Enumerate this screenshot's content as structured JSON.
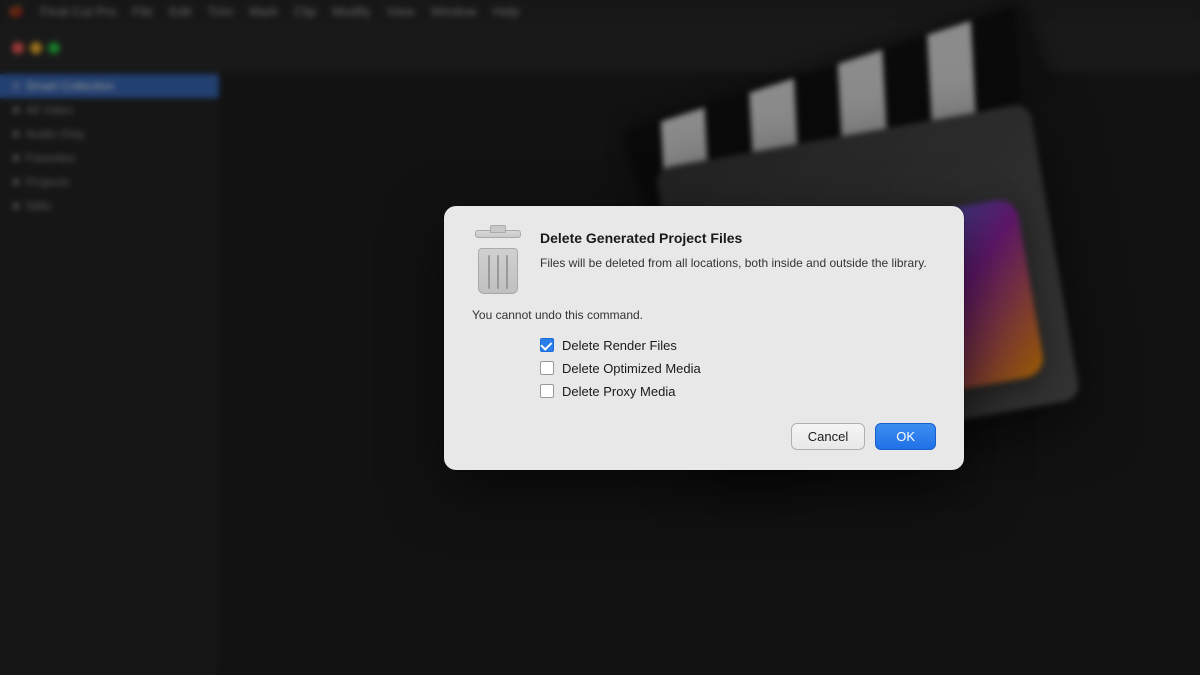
{
  "menubar": {
    "apple": "🍎",
    "items": [
      "Final Cut Pro",
      "File",
      "Edit",
      "Trim",
      "Mark",
      "Clip",
      "Modify",
      "View",
      "Window",
      "Help"
    ]
  },
  "sidebar": {
    "items": [
      {
        "label": "All Video",
        "active": false
      },
      {
        "label": "Audio Only",
        "active": false
      },
      {
        "label": "Favorites",
        "active": false
      },
      {
        "label": "Projects",
        "active": false
      },
      {
        "label": "Stills",
        "active": false
      }
    ],
    "active_library": "Smart Collection"
  },
  "dialog": {
    "title": "Delete Generated Project Files",
    "description": "Files will be deleted from all locations, both inside and outside the library.",
    "warning": "You cannot undo this command.",
    "checkboxes": [
      {
        "label": "Delete Render Files",
        "checked": true
      },
      {
        "label": "Delete Optimized Media",
        "checked": false
      },
      {
        "label": "Delete Proxy Media",
        "checked": false
      }
    ],
    "buttons": {
      "cancel": "Cancel",
      "ok": "OK"
    }
  }
}
